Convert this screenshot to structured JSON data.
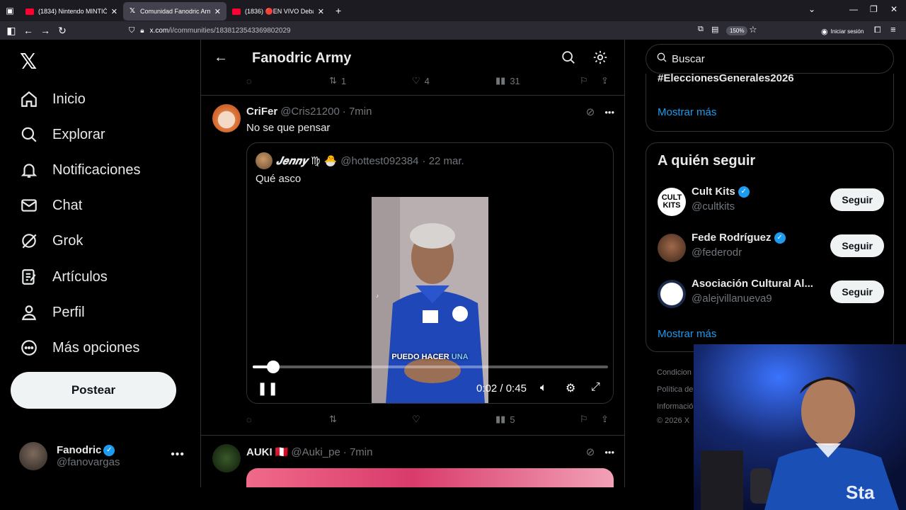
{
  "browser": {
    "tabs": [
      {
        "label": "(1834) Nintendo MINTIÓ para l",
        "icon": "youtube-icon",
        "active": false
      },
      {
        "label": "Comunidad Fanodric Army / X",
        "icon": "x-icon",
        "active": true
      },
      {
        "label": "(1836) 🔴EN VIVO Debate pres",
        "icon": "youtube-icon",
        "active": false
      }
    ],
    "url_domain": "x.com",
    "url_path": "/i/communities/1838123543369802029",
    "zoom": "150%",
    "signin": "Iniciar sesión"
  },
  "nav": {
    "items": [
      {
        "label": "Inicio",
        "icon": "home-icon"
      },
      {
        "label": "Explorar",
        "icon": "search-icon"
      },
      {
        "label": "Notificaciones",
        "icon": "bell-icon"
      },
      {
        "label": "Chat",
        "icon": "mail-icon"
      },
      {
        "label": "Grok",
        "icon": "grok-icon"
      },
      {
        "label": "Artículos",
        "icon": "article-icon"
      },
      {
        "label": "Perfil",
        "icon": "person-icon"
      },
      {
        "label": "Más opciones",
        "icon": "more-circle-icon"
      }
    ],
    "post_label": "Postear",
    "account": {
      "name": "Fanodric",
      "handle": "@fanovargas"
    }
  },
  "header": {
    "title": "Fanodric Army"
  },
  "prev_tweet_actions": {
    "retweets": "1",
    "likes": "4",
    "views": "31"
  },
  "tweet1": {
    "name": "CriFer",
    "handle": "@Cris21200",
    "time": "· 7min",
    "text": "No se que pensar",
    "quote": {
      "name": "𝑱𝒆𝒏𝒏𝒚 ♍",
      "emoji": "🐣",
      "handle": "@hottest092384",
      "date": "· 22 mar.",
      "text": "Qué asco",
      "video": {
        "caption_start": "PUEDO HACER ",
        "caption_highlight": "UNA",
        "current_time": "0:02",
        "separator": "/",
        "duration": "0:45",
        "progress_fraction": 0.044
      }
    },
    "actions": {
      "likes": "",
      "views": "5"
    }
  },
  "tweet2": {
    "name": "AUKI",
    "flag": "🇵🇪",
    "handle": "@Auki_pe",
    "time": "· 7min"
  },
  "right": {
    "search_placeholder": "Buscar",
    "trend_hashtag": "#EleccionesGenerales2026",
    "show_more": "Mostrar más",
    "follow_title": "A quién seguir",
    "follow": [
      {
        "name": "Cult Kits",
        "handle": "@cultkits",
        "verified": true,
        "button": "Seguir"
      },
      {
        "name": "Fede Rodríguez",
        "handle": "@federodr",
        "verified": true,
        "button": "Seguir"
      },
      {
        "name": "Asociación Cultural Al...",
        "handle": "@alejvillanueva9",
        "verified": false,
        "button": "Seguir"
      }
    ],
    "show_more_2": "Mostrar más",
    "footer": [
      "Condicion",
      "Política de",
      "Informació",
      "© 2026 X"
    ]
  },
  "colors": {
    "accent": "#1d9bf0",
    "border": "#2f3336",
    "muted": "#71767b",
    "text": "#e7e9ea"
  }
}
